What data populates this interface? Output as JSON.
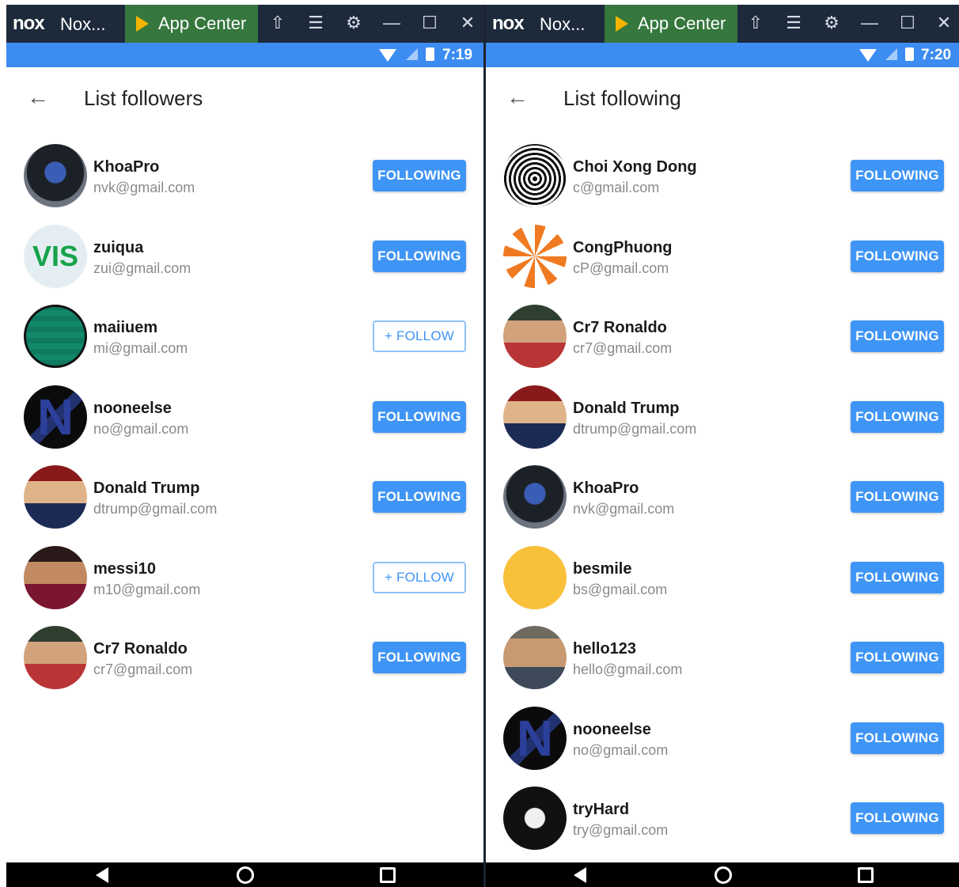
{
  "window": {
    "logo": "nox",
    "name": "Nox...",
    "app_center_label": "App Center",
    "icons": [
      "shirt-icon",
      "menu-icon",
      "settings-icon",
      "minimize-icon",
      "maximize-icon",
      "close-icon"
    ]
  },
  "left": {
    "status_time": "7:19",
    "title": "List followers",
    "items": [
      {
        "name": "KhoaPro",
        "email": "nvk@gmail.com",
        "button": "FOLLOWING",
        "state": "following"
      },
      {
        "name": "zuiqua",
        "email": "zui@gmail.com",
        "button": "FOLLOWING",
        "state": "following",
        "avatar_text": "VIS"
      },
      {
        "name": "maiiuem",
        "email": "mi@gmail.com",
        "button": "+ FOLLOW",
        "state": "follow"
      },
      {
        "name": "nooneelse",
        "email": "no@gmail.com",
        "button": "FOLLOWING",
        "state": "following",
        "avatar_text": "N"
      },
      {
        "name": "Donald Trump",
        "email": "dtrump@gmail.com",
        "button": "FOLLOWING",
        "state": "following"
      },
      {
        "name": "messi10",
        "email": "m10@gmail.com",
        "button": "+ FOLLOW",
        "state": "follow"
      },
      {
        "name": "Cr7 Ronaldo",
        "email": "cr7@gmail.com",
        "button": "FOLLOWING",
        "state": "following"
      }
    ]
  },
  "right": {
    "status_time": "7:20",
    "title": "List following",
    "items": [
      {
        "name": "Choi Xong Dong",
        "email": "c@gmail.com",
        "button": "FOLLOWING",
        "state": "following"
      },
      {
        "name": "CongPhuong",
        "email": "cP@gmail.com",
        "button": "FOLLOWING",
        "state": "following"
      },
      {
        "name": "Cr7 Ronaldo",
        "email": "cr7@gmail.com",
        "button": "FOLLOWING",
        "state": "following"
      },
      {
        "name": "Donald Trump",
        "email": "dtrump@gmail.com",
        "button": "FOLLOWING",
        "state": "following"
      },
      {
        "name": "KhoaPro",
        "email": "nvk@gmail.com",
        "button": "FOLLOWING",
        "state": "following"
      },
      {
        "name": "besmile",
        "email": "bs@gmail.com",
        "button": "FOLLOWING",
        "state": "following"
      },
      {
        "name": "hello123",
        "email": "hello@gmail.com",
        "button": "FOLLOWING",
        "state": "following"
      },
      {
        "name": "nooneelse",
        "email": "no@gmail.com",
        "button": "FOLLOWING",
        "state": "following",
        "avatar_text": "N"
      },
      {
        "name": "tryHard",
        "email": "try@gmail.com",
        "button": "FOLLOWING",
        "state": "following"
      }
    ]
  },
  "colors": {
    "titlebar": "#1d2a3b",
    "app_center": "#35773d",
    "status_bar": "#3c8cf1",
    "button_primary": "#3f95f6"
  }
}
